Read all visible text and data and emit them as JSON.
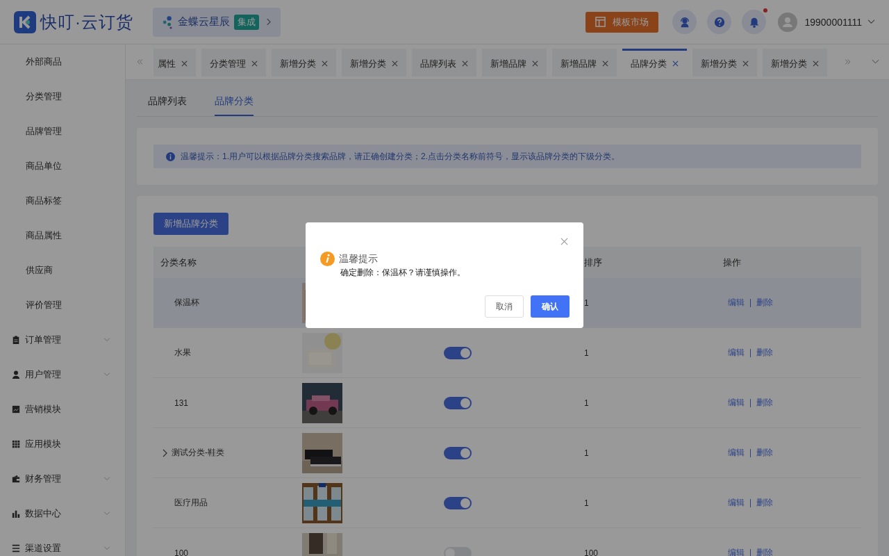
{
  "header": {
    "logo": "快叮·云订货",
    "partner": {
      "name": "金蝶云星辰",
      "badge": "集成"
    },
    "market_button": "模板市场",
    "notifications": {
      "unread": true
    },
    "user": "19900001111"
  },
  "sidebar": {
    "items": [
      {
        "kind": "leaf",
        "label": "外部商品"
      },
      {
        "kind": "leaf",
        "label": "分类管理"
      },
      {
        "kind": "leaf",
        "label": "品牌管理"
      },
      {
        "kind": "leaf",
        "label": "商品单位"
      },
      {
        "kind": "leaf",
        "label": "商品标签"
      },
      {
        "kind": "leaf",
        "label": "商品属性"
      },
      {
        "kind": "leaf",
        "label": "供应商"
      },
      {
        "kind": "leaf",
        "label": "评价管理"
      },
      {
        "kind": "group",
        "label": "订单管理",
        "expandable": true
      },
      {
        "kind": "group",
        "label": "用户管理",
        "expandable": true
      },
      {
        "kind": "group",
        "label": "营销模块",
        "expandable": false
      },
      {
        "kind": "group",
        "label": "应用模块",
        "expandable": false
      },
      {
        "kind": "group",
        "label": "财务管理",
        "expandable": true
      },
      {
        "kind": "group",
        "label": "数据中心",
        "expandable": true
      },
      {
        "kind": "group",
        "label": "渠道设置",
        "expandable": true
      }
    ]
  },
  "page_tabs": [
    {
      "label": "属性",
      "selected": false
    },
    {
      "label": "分类管理",
      "selected": false
    },
    {
      "label": "新增分类",
      "selected": false
    },
    {
      "label": "新增分类",
      "selected": false
    },
    {
      "label": "品牌列表",
      "selected": false
    },
    {
      "label": "新增品牌",
      "selected": false
    },
    {
      "label": "新增品牌",
      "selected": false
    },
    {
      "label": "品牌分类",
      "selected": true
    },
    {
      "label": "新增分类",
      "selected": false
    },
    {
      "label": "新增分类",
      "selected": false
    }
  ],
  "sub_tabs": [
    {
      "label": "品牌列表",
      "selected": false
    },
    {
      "label": "品牌分类",
      "selected": true
    }
  ],
  "tip": "温馨提示：1.用户可以根据品牌分类搜索品牌，请正确创建分类；2.点击分类名称前符号，显示该品牌分类的下级分类。",
  "add_button": "新增品牌分类",
  "table": {
    "columns": [
      "分类名称",
      "排序",
      "操作"
    ],
    "rows": [
      {
        "name": "保温杯",
        "sort": "1",
        "edit": "编辑",
        "delete": "删除",
        "selected": true
      },
      {
        "name": "水果",
        "enabled": true,
        "sort": "1",
        "edit": "编辑",
        "delete": "删除",
        "selected": false
      },
      {
        "name": "131",
        "enabled": true,
        "sort": "1",
        "edit": "编辑",
        "delete": "删除",
        "selected": false
      },
      {
        "name": "测试分类-鞋类",
        "expanded": false,
        "enabled": true,
        "sort": "1",
        "edit": "编辑",
        "delete": "删除",
        "selected": false
      },
      {
        "name": "医疗用品",
        "enabled": true,
        "sort": "1",
        "edit": "编辑",
        "delete": "删除",
        "selected": false
      },
      {
        "name": "100",
        "enabled": false,
        "sort": "100",
        "edit": "编辑",
        "delete": "删除",
        "selected": false
      }
    ]
  },
  "dialog": {
    "title": "温馨提示",
    "message": "确定删除：保温杯？请谨慎操作。",
    "cancel": "取消",
    "confirm": "确认"
  }
}
